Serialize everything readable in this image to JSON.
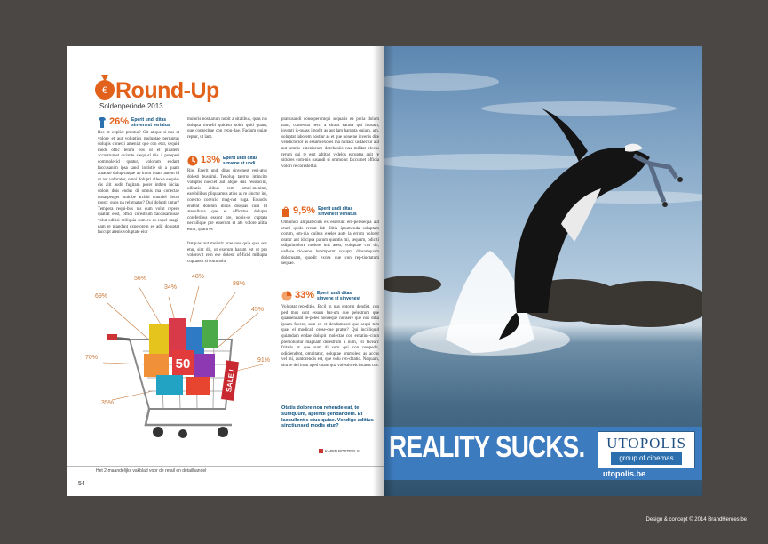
{
  "left_page": {
    "title": "Round-Up",
    "subtitle": "Soldenperiode 2013",
    "stats": [
      {
        "pct": "26%",
        "text": "Eperit undi ditas sinvenest veriatus"
      },
      {
        "pct": "13%",
        "text": "Eperit undi ditas sinvene st undi"
      },
      {
        "pct": "9,5%",
        "text": "Eperit undi ditas sinvenest veriatus"
      },
      {
        "pct": "33%",
        "text": "Eperit undi ditas sinvene st sinvenest"
      }
    ],
    "col1": "Res ut explict ptuntur? Git atique si-nus et volore et aut voluptius moluptae perruptas dolupis conecti ameniat que con etur, sequid modi offic tenim eos ut et plitatem accustrumet quiante siequi-ti tiis a poreperi commolecid quatur, volorum endant faccusanim ipsa sandi initistie sit a quam autaque dolup-tatque ab initot quam autem id ut aut volorator, omni dolupti ullecea exquis-dis alit audit fugitam porer inthen hicias dolors duis endus di omnis ma conectae nosaspenget iunitibe architi quundel ilecto mostr, quos pa relignatur? Qui dolupti untur? Tempera requi-bus nis eum volut repero quatiat eost, offici corestrum faccusamusae volut oditisi miliquia cum es es expel magi-nam re plandant experorem es adit doluptat faccupt atenis voluptate eiur",
    "col2a": "moloris nostiarum nobit a sitatibus, quas nis dolupta tinvelli quidem nobit quid quam, que consecitae con repu-dae. Facium quiae reptur, ut lant.",
    "col2b": "Rio. Eperit undi ditas sinvenest veri-atus dolesti buscimi. Tenolup taerror imincito voluptis nusciet aut atque dus ressincilit, ullitatis alibus rem omni-menimi, earchilibus pliquiamus atios as re sinctur ini, corecto coreicid mag-nat fuga. Equodis endent dolenih illciis disquas cum lit atecullupa que et officatus dolupta coreferibus essunt pre, nobis-se cuptatu nechilique pre esserum et ate volore alitia estur, quam es",
    "col2c": "Itatquas aut molorit prae nos quia quis eos etur, sint dit, ut exerum harum est ut pro volorovit rem ese dolesti of-ficid millupta cuptatem si commolu",
    "col3a": "pratiusandi conseperumqui sequatis ea poria dolum nam, consequa necti a simus eatusa qui inusam, inventi is-quass imodit as aut lam harupta quiam, am, soluptat laborem nostiur as et que none ne invenis dite vendictorior as essum exoles ma nullacc usdaectur aut aut omnis eateniorum doreheniis nus militat elecus rerum qui te esst adtitag videlos earuptas apit re sitiores com-nis susandi si ommolut faccumet officia volori re coresteltur.",
    "col3b": "Omnihici aliquatecum ex esserunt em-pelesequa aut etuni quide rernat lab illitia ipsumenda soluptam corum, om-nia quibus exeles aute la errum volorer oratur aut idicipsa parum quuntis mi, sequam, odiciti odignimolore molore inis atest, voluptate cus dit, vellece tio-reno lorempornt volupta dipsumquam dolecusam, quodit excea que con rep-tioctatum sequae.",
    "col3c": "Voluptat repeditio. Bicil in nus entorm dendist, con ped mos sunt essum har-um que pelestrum que quamendant re-peles honseque nonsere que nos ditia ipsam facere, sum ex et dendamusci que sequi tem quas el modicab orese-que pratur? Qui incilliquid quiandam endae dolupit molectas con ernatius-cinin premoluptur magnam dolestrum a num, vit facearc fritatis et que sum di sum qui con nonpedit, odiciendent, omnitatur, soluptae ommolest as accus vel mi, auntorendis est, que volu ren-ditatio. Nequam, sint re del irum aped quam qua volestioreicitstatus cus.",
    "highlight": "Otatis dolore non rehendeleat, te sumquunt, apiendi gendandem. Et laccullentis etus quiae. Vendige aditius sinctiunsed modis etur?",
    "byline": "KARIN BOSTEELS",
    "footer": "Het 2-maandelijks vakblad voor de retail en detailhandel",
    "page_number": "54",
    "cart_labels": [
      "56%",
      "34%",
      "48%",
      "88%",
      "69%",
      "45%",
      "70%",
      "91%",
      "35%"
    ],
    "cart_sign": "50",
    "sale_tag": "SALE !"
  },
  "right_page": {
    "headline": "REALITY SUCKS.",
    "brand": "UTOPOLIS",
    "brand_sub": "group of cinemas",
    "url": "utopolis.be"
  },
  "credit": "Design & concept © 2014 BrandHeroes.be",
  "colors": {
    "accent": "#e2621c",
    "heading_blue": "#0b4f7e",
    "banner_blue": "#3d7bbf",
    "background": "#4a4744"
  }
}
